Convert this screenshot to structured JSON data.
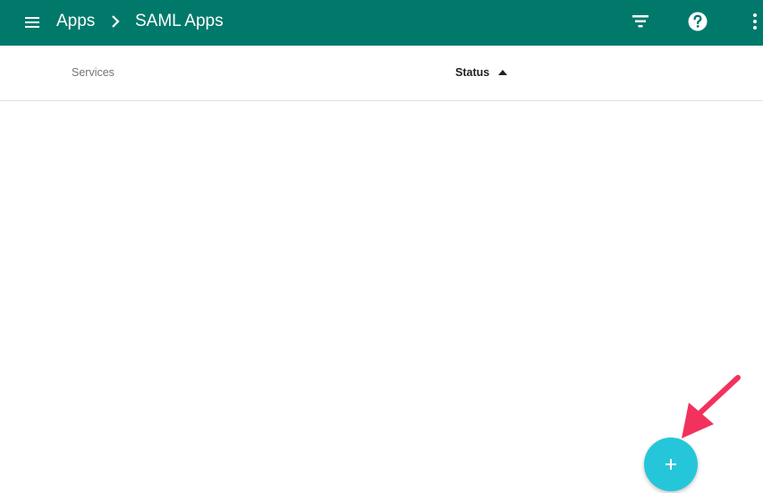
{
  "header": {
    "menu_icon": "hamburger-menu-icon",
    "breadcrumb": {
      "parent": "Apps",
      "separator_icon": "chevron-right-icon",
      "current": "SAML Apps"
    },
    "actions": {
      "filter_icon": "filter-icon",
      "help_icon": "help-icon",
      "more_icon": "more-vert-icon"
    },
    "background_color": "#00796b"
  },
  "table": {
    "columns": [
      {
        "label": "Services"
      },
      {
        "label": "Status",
        "sort": "ascending",
        "sort_icon": "sort-up-icon"
      }
    ],
    "rows": []
  },
  "fab": {
    "icon": "plus-icon",
    "color": "#26c6da"
  },
  "annotation": {
    "icon": "pointer-arrow-icon",
    "color": "#f2325c"
  }
}
